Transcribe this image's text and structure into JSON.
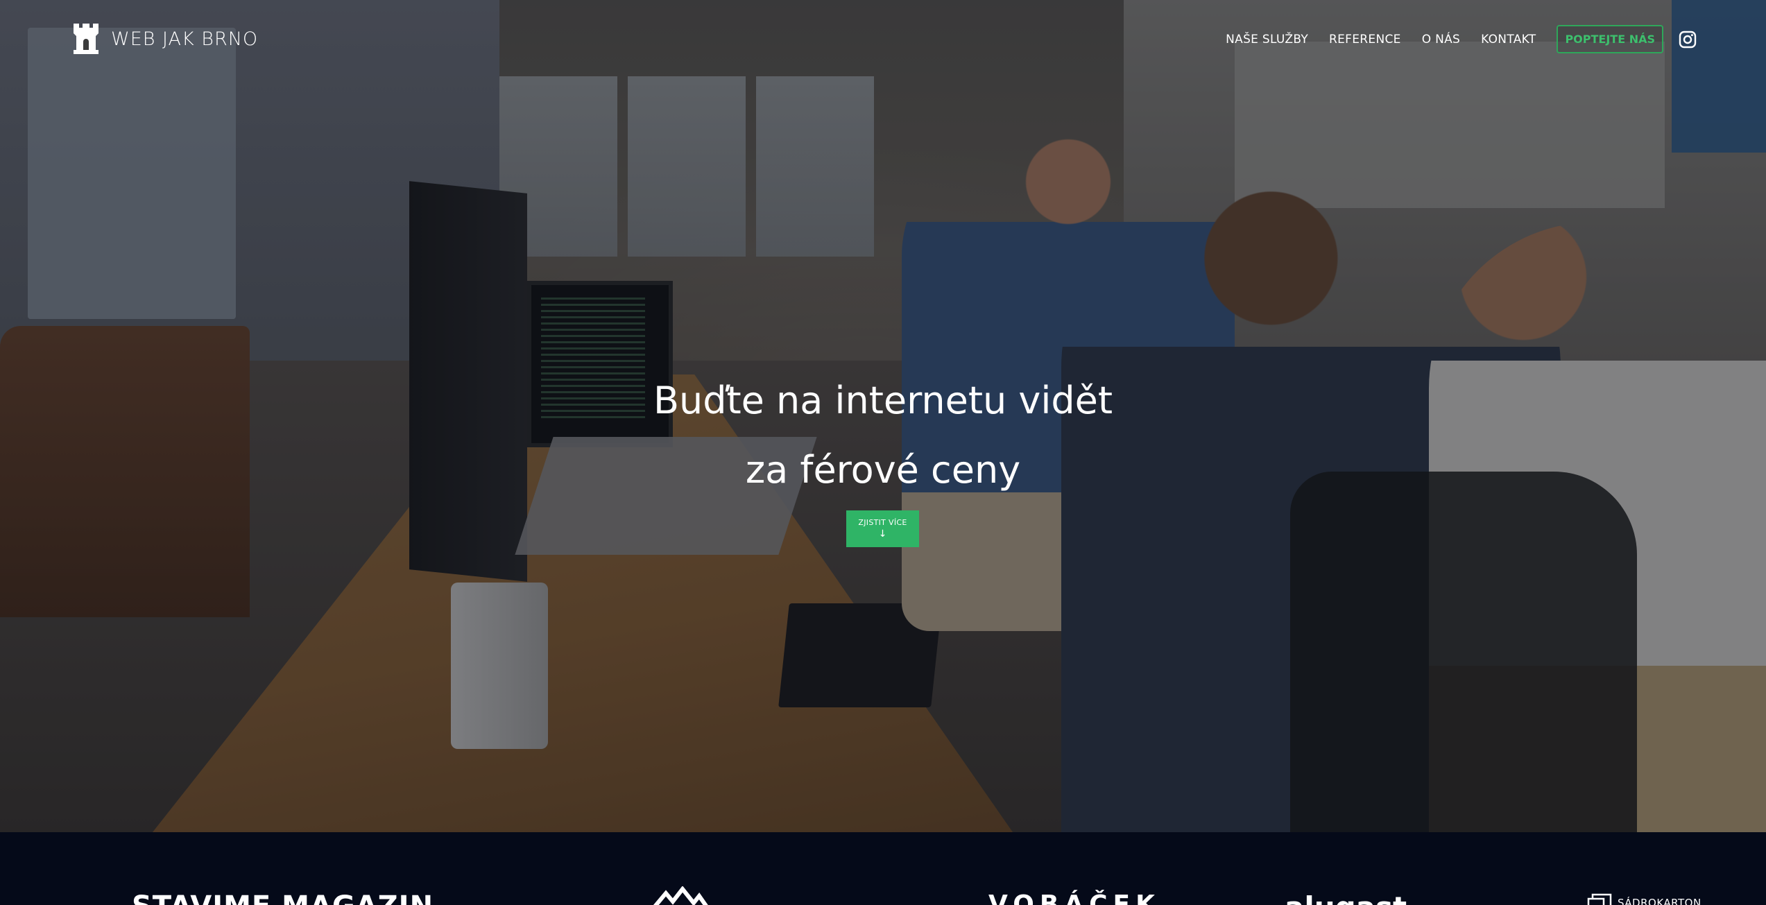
{
  "brand": {
    "name": "WEB JAK BRNO",
    "icon": "castle-tower-icon"
  },
  "nav": {
    "links": [
      "NAŠE SLUŽBY",
      "REFERENCE",
      "O NÁS",
      "KONTAKT"
    ],
    "cta_label": "POPTEJTE NÁS",
    "social_icon": "instagram-icon"
  },
  "hero": {
    "headline_line1": "Buďte na internetu vidět",
    "headline_line2": "za férové ceny",
    "button_label": "ZJISTIT VÍCE",
    "button_arrow": "↓"
  },
  "logos": {
    "stavime": "STAVIME MAGAZIN",
    "vobacek": "VOBÁČEK",
    "alugast": "alugast",
    "sadrokarton": "SÁDROKARTON"
  },
  "colors": {
    "accent_green": "#2fb466",
    "cta_outline": "#2ea75a",
    "footer_background": "#050a19"
  }
}
